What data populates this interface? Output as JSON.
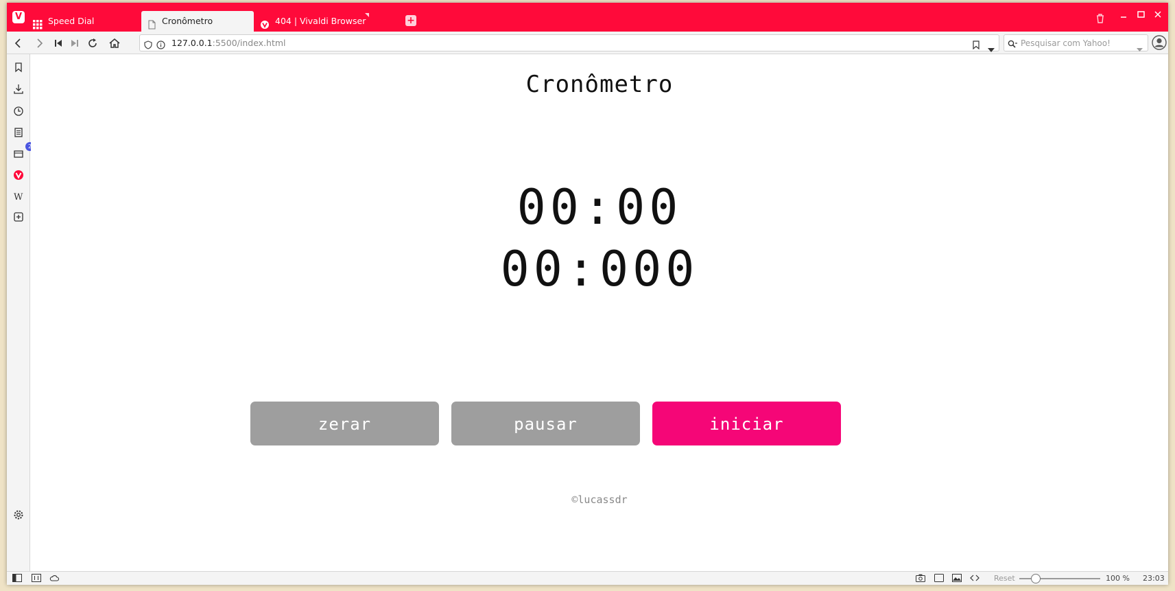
{
  "browser": {
    "tabs": [
      {
        "label": "Speed Dial",
        "icon": "grid-icon",
        "active": false
      },
      {
        "label": "Cronômetro",
        "icon": "page-icon",
        "active": true
      },
      {
        "label": "404 | Vivaldi Browser",
        "icon": "vivaldi-icon",
        "active": false
      }
    ],
    "address": {
      "host": "127.0.0.1",
      "path": ":5500/index.html"
    },
    "search": {
      "placeholder": "Pesquisar com Yahoo!"
    },
    "side_panel": {
      "window_badge": "2"
    },
    "status": {
      "reset_label": "Reset",
      "zoom": "100 %",
      "zoom_level": 0.2,
      "clock": "23:03"
    },
    "accent_color": "#ff0a3a"
  },
  "page": {
    "title": "Cronômetro",
    "timer": {
      "line1": "00:00",
      "line2": "00:000"
    },
    "buttons": {
      "reset": "zerar",
      "pause": "pausar",
      "start": "iniciar"
    },
    "footer": "©lucassdr",
    "colors": {
      "button_gray": "#9e9e9e",
      "button_pink": "#f50677"
    }
  }
}
